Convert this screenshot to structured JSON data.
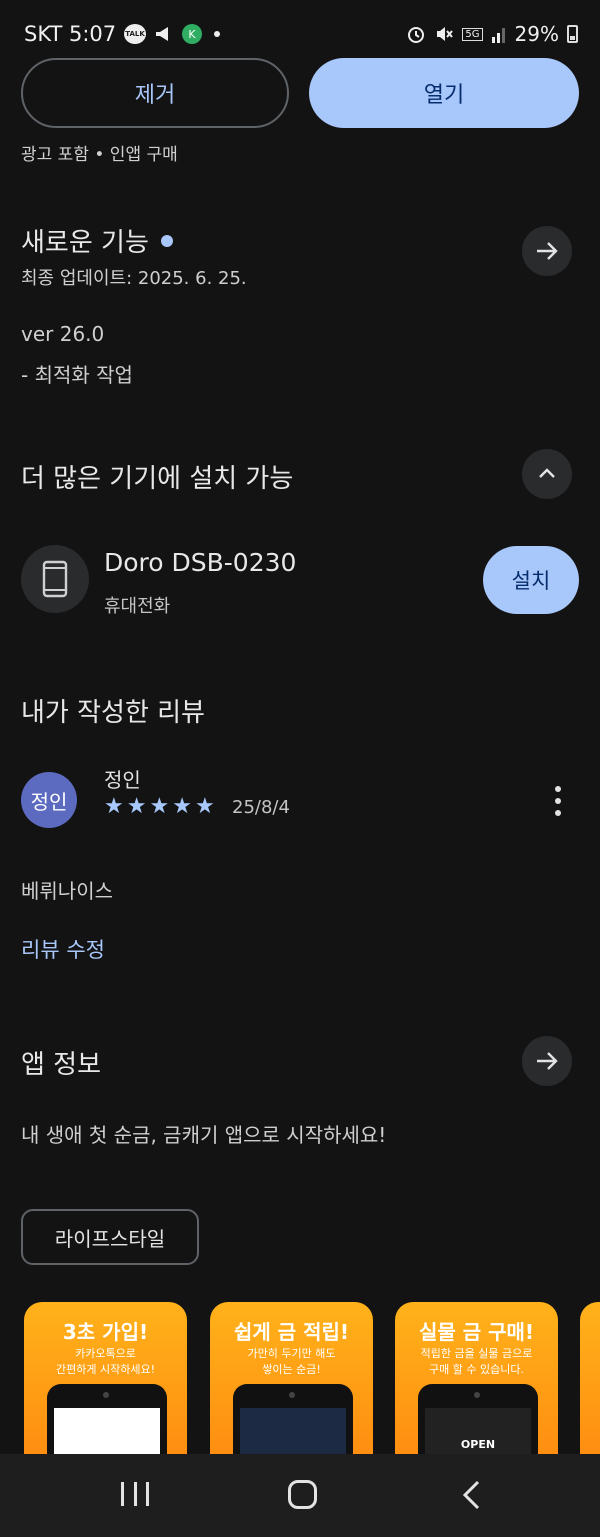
{
  "status_bar": {
    "time": "SKT 5:07",
    "talk_badge": "TALK",
    "k_badge": "K",
    "network": "5G",
    "battery": "29%"
  },
  "actions": {
    "remove_label": "제거",
    "open_label": "열기"
  },
  "ads_note": "광고 포함 • 인앱 구매",
  "whats_new": {
    "title": "새로운 기능",
    "last_updated": "최종 업데이트: 2025. 6. 25.",
    "version": "ver 26.0",
    "notes": "- 최적화 작업"
  },
  "more_devices": {
    "title": "더 많은 기기에 설치 가능",
    "device_name": "Doro DSB-0230",
    "device_type": "휴대전화",
    "install_label": "설치"
  },
  "my_review": {
    "title": "내가 작성한 리뷰",
    "avatar_text": "정인",
    "reviewer": "정인",
    "rating": 5,
    "date": "25/8/4",
    "text": "베뤼나이스",
    "edit_label": "리뷰 수정"
  },
  "app_info": {
    "title": "앱 정보",
    "description": "내 생애 첫 순금, 금캐기 앱으로 시작하세요!",
    "category": "라이프스타일"
  },
  "screenshots": [
    {
      "title": "3초 가입!",
      "subtitle": "카카오톡으로\n간편하게 시작하세요!"
    },
    {
      "title": "쉽게 금 적립!",
      "subtitle": "가만히 두기만 해도\n쌓이는 순금!"
    },
    {
      "title": "실물 금 구매!",
      "subtitle": "적립한 금을 실물 금으로\n구매 할 수 있습니다."
    }
  ],
  "screenshot_open_label": "OPEN",
  "colors": {
    "background": "#131314",
    "accent": "#a8c7fa",
    "accent_text": "#062e6f",
    "avatar": "#5c6bc0",
    "promo_orange": "#ff9a14"
  }
}
